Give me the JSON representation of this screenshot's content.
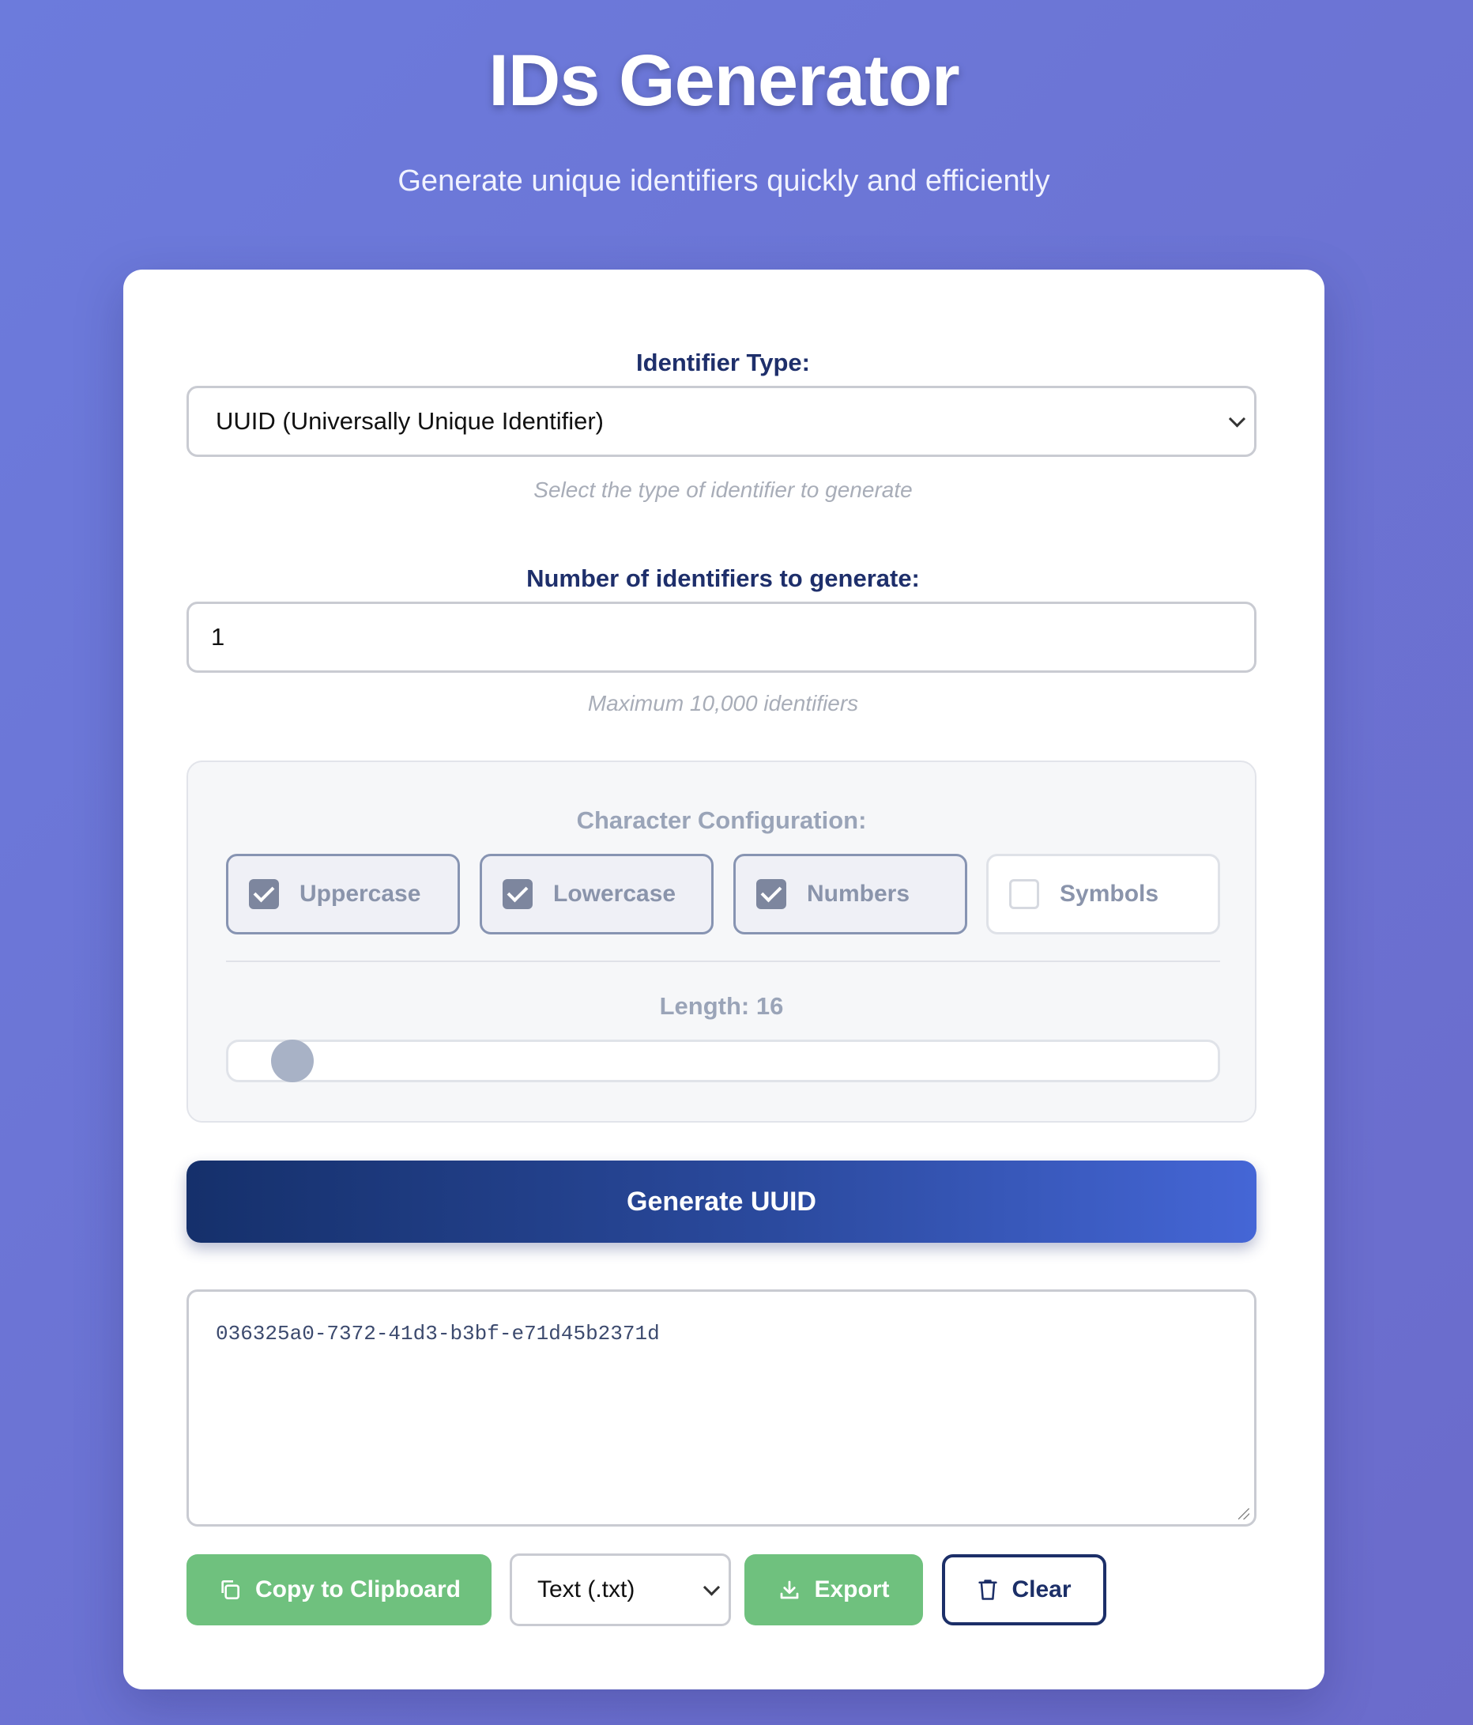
{
  "header": {
    "title": "IDs Generator",
    "subtitle": "Generate unique identifiers quickly and efficiently"
  },
  "identifier_type": {
    "label": "Identifier Type:",
    "selected": "UUID (Universally Unique Identifier)",
    "hint": "Select the type of identifier to generate"
  },
  "count": {
    "label": "Number of identifiers to generate:",
    "value": "1",
    "hint": "Maximum 10,000 identifiers"
  },
  "character_config": {
    "title": "Character Configuration:",
    "options": [
      {
        "label": "Uppercase",
        "checked": true
      },
      {
        "label": "Lowercase",
        "checked": true
      },
      {
        "label": "Numbers",
        "checked": true
      },
      {
        "label": "Symbols",
        "checked": false
      }
    ],
    "length_label": "Length: 16",
    "length_value": 16,
    "length_slider_fraction": 0.045
  },
  "generate_button": {
    "label": "Generate UUID"
  },
  "output": {
    "text": "036325a0-7372-41d3-b3bf-e71d45b2371d"
  },
  "actions": {
    "copy_label": "Copy to Clipboard",
    "format_selected": "Text (.txt)",
    "export_label": "Export",
    "clear_label": "Clear"
  },
  "colors": {
    "accent_green": "#6fc17e",
    "primary_dark": "#1c2f68",
    "background": "#6c7bdc"
  }
}
